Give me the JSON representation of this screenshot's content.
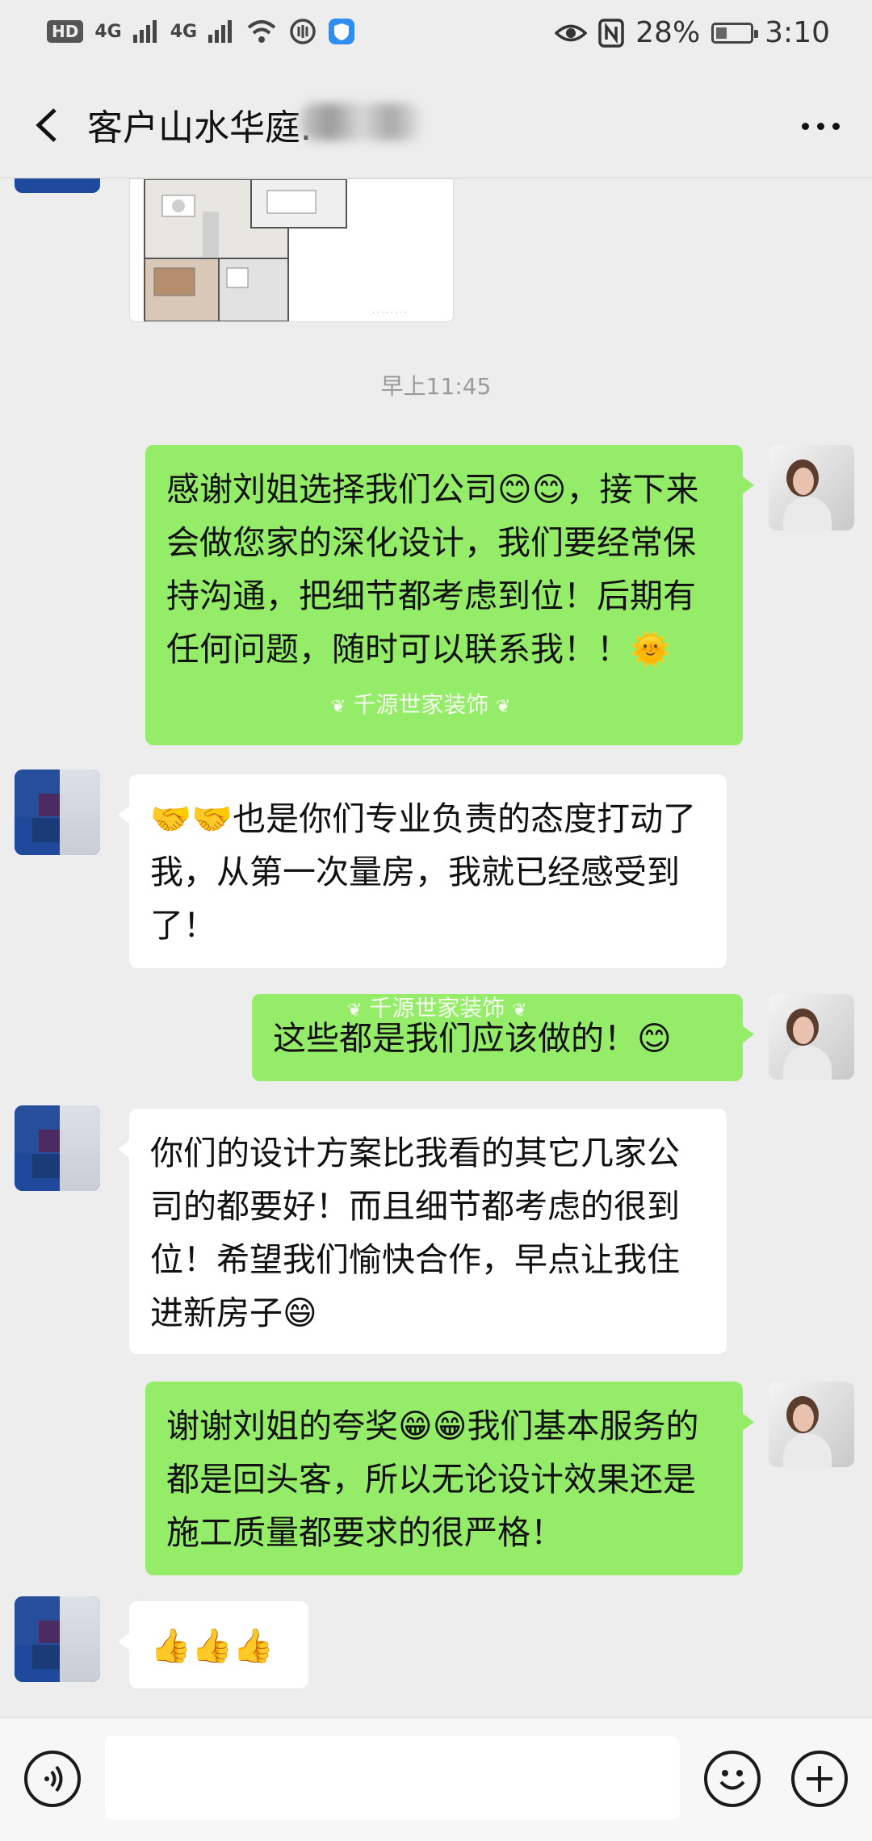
{
  "status_bar": {
    "network1": "4G",
    "network2": "4G",
    "battery_pct": "28%",
    "time": "3:10",
    "hd": "HD"
  },
  "header": {
    "title": "客户山水华庭."
  },
  "chat": {
    "timestamp": "早上11:45",
    "watermark": "千源世家装饰",
    "messages": [
      {
        "sender": "me",
        "text": "感谢刘姐选择我们公司😊😊，接下来会做您家的深化设计，我们要经常保持沟通，把细节都考虑到位！后期有任何问题，随时可以联系我！！🌞"
      },
      {
        "sender": "customer",
        "text": "🤝🤝也是你们专业负责的态度打动了我，从第一次量房，我就已经感受到了！"
      },
      {
        "sender": "me",
        "text": "这些都是我们应该做的！😊"
      },
      {
        "sender": "customer",
        "text": "你们的设计方案比我看的其它几家公司的都要好！而且细节都考虑的很到位！希望我们愉快合作，早点让我住进新房子😄"
      },
      {
        "sender": "me",
        "text": "谢谢刘姐的夸奖😁😁我们基本服务的都是回头客，所以无论设计效果还是施工质量都要求的很严格！"
      },
      {
        "sender": "customer",
        "text": "👍👍👍"
      }
    ]
  },
  "colors": {
    "my_bubble": "#95ec69",
    "their_bubble": "#ffffff",
    "background": "#ededed"
  }
}
